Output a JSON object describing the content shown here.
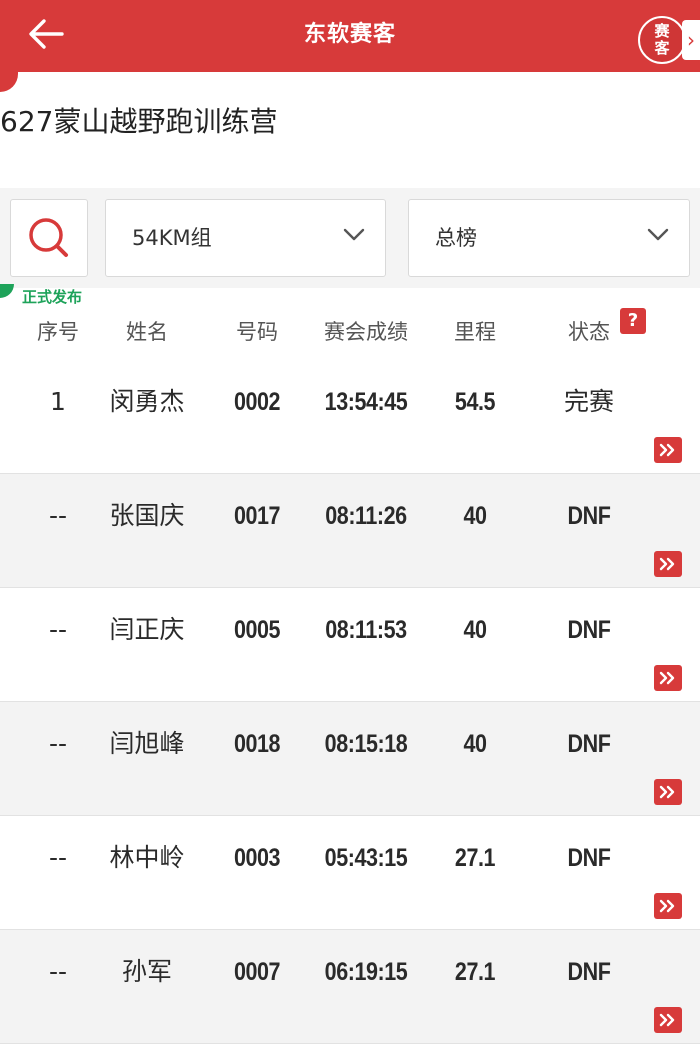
{
  "header": {
    "title": "东软赛客",
    "badge_text": "赛客",
    "badge_chevron": "›",
    "accent_color": "#d73a3a"
  },
  "event": {
    "title": "627蒙山越野跑训练营"
  },
  "filters": {
    "group": "54KM组",
    "board": "总榜"
  },
  "status_tag": "正式发布",
  "help_label": "?",
  "table": {
    "columns": [
      "序号",
      "姓名",
      "号码",
      "赛会成绩",
      "里程",
      "状态"
    ],
    "rows": [
      {
        "rank": "1",
        "name": "闵勇杰",
        "bib": "0002",
        "time": "13:54:45",
        "distance": "54.5",
        "status": "完赛"
      },
      {
        "rank": "--",
        "name": "张国庆",
        "bib": "0017",
        "time": "08:11:26",
        "distance": "40",
        "status": "DNF"
      },
      {
        "rank": "--",
        "name": "闫正庆",
        "bib": "0005",
        "time": "08:11:53",
        "distance": "40",
        "status": "DNF"
      },
      {
        "rank": "--",
        "name": "闫旭峰",
        "bib": "0018",
        "time": "08:15:18",
        "distance": "40",
        "status": "DNF"
      },
      {
        "rank": "--",
        "name": "林中岭",
        "bib": "0003",
        "time": "05:43:15",
        "distance": "27.1",
        "status": "DNF"
      },
      {
        "rank": "--",
        "name": "孙军",
        "bib": "0007",
        "time": "06:19:15",
        "distance": "27.1",
        "status": "DNF"
      }
    ]
  }
}
